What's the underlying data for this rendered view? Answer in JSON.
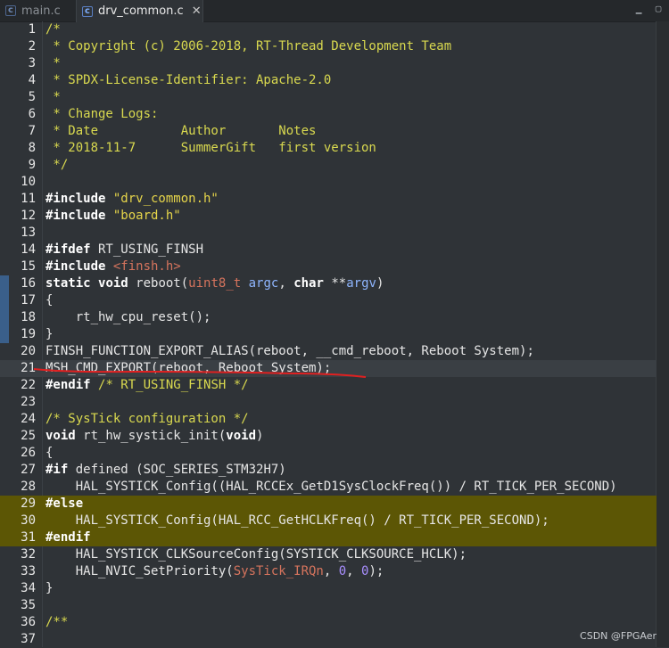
{
  "tabs": [
    {
      "label": "main.c",
      "active": false
    },
    {
      "label": "drv_common.c",
      "active": true
    }
  ],
  "watermark": "CSDN @FPGAer",
  "lines": [
    {
      "n": "1",
      "segs": [
        [
          "cmt",
          "/*"
        ]
      ]
    },
    {
      "n": "2",
      "segs": [
        [
          "cmt",
          " * Copyright (c) 2006-2018, RT-Thread Development Team"
        ]
      ]
    },
    {
      "n": "3",
      "segs": [
        [
          "cmt",
          " *"
        ]
      ]
    },
    {
      "n": "4",
      "segs": [
        [
          "cmt",
          " * SPDX-License-Identifier: Apache-2.0"
        ]
      ]
    },
    {
      "n": "5",
      "segs": [
        [
          "cmt",
          " *"
        ]
      ]
    },
    {
      "n": "6",
      "segs": [
        [
          "cmt",
          " * Change Logs:"
        ]
      ]
    },
    {
      "n": "7",
      "segs": [
        [
          "cmt",
          " * Date           Author       Notes"
        ]
      ]
    },
    {
      "n": "8",
      "segs": [
        [
          "cmt",
          " * 2018-11-7      SummerGift   first version"
        ]
      ]
    },
    {
      "n": "9",
      "segs": [
        [
          "cmt",
          " */"
        ]
      ]
    },
    {
      "n": "10",
      "segs": []
    },
    {
      "n": "11",
      "segs": [
        [
          "pp",
          "#include "
        ],
        [
          "str",
          "\"drv_common.h\""
        ]
      ]
    },
    {
      "n": "12",
      "segs": [
        [
          "pp",
          "#include "
        ],
        [
          "str",
          "\"board.h\""
        ]
      ]
    },
    {
      "n": "13",
      "segs": []
    },
    {
      "n": "14",
      "segs": [
        [
          "pp",
          "#ifdef"
        ],
        [
          "",
          " RT_USING_FINSH"
        ]
      ]
    },
    {
      "n": "15",
      "segs": [
        [
          "pp",
          "#include "
        ],
        [
          "inc",
          "<finsh.h>"
        ]
      ]
    },
    {
      "n": "16",
      "segs": [
        [
          "kw",
          "static"
        ],
        [
          "",
          " "
        ],
        [
          "kw",
          "void"
        ],
        [
          "",
          " reboot("
        ],
        [
          "typ",
          "uint8_t"
        ],
        [
          "",
          " "
        ],
        [
          "param",
          "argc"
        ],
        [
          "",
          ", "
        ],
        [
          "kw",
          "char"
        ],
        [
          "",
          " **"
        ],
        [
          "param",
          "argv"
        ],
        [
          "",
          ")"
        ]
      ]
    },
    {
      "n": "17",
      "segs": [
        [
          "",
          "{"
        ]
      ]
    },
    {
      "n": "18",
      "segs": [
        [
          "",
          "    rt_hw_cpu_reset();"
        ]
      ]
    },
    {
      "n": "19",
      "segs": [
        [
          "",
          "}"
        ]
      ]
    },
    {
      "n": "20",
      "segs": [
        [
          "",
          "FINSH_FUNCTION_EXPORT_ALIAS(reboot, __cmd_reboot, Reboot System);"
        ]
      ]
    },
    {
      "n": "21",
      "segs": [
        [
          "",
          "MSH_CMD_EXPORT(reboot, Reboot System);"
        ]
      ]
    },
    {
      "n": "22",
      "segs": [
        [
          "pp",
          "#endif"
        ],
        [
          "",
          " "
        ],
        [
          "cmt",
          "/* RT_USING_FINSH */"
        ]
      ]
    },
    {
      "n": "23",
      "segs": []
    },
    {
      "n": "24",
      "segs": [
        [
          "cmt",
          "/* SysTick configuration */"
        ]
      ]
    },
    {
      "n": "25",
      "segs": [
        [
          "kw",
          "void"
        ],
        [
          "",
          " rt_hw_systick_init("
        ],
        [
          "kw",
          "void"
        ],
        [
          "",
          ")"
        ]
      ]
    },
    {
      "n": "26",
      "segs": [
        [
          "",
          "{"
        ]
      ]
    },
    {
      "n": "27",
      "segs": [
        [
          "pp",
          "#if"
        ],
        [
          "",
          " defined (SOC_SERIES_STM32H7)"
        ]
      ]
    },
    {
      "n": "28",
      "segs": [
        [
          "",
          "    HAL_SYSTICK_Config((HAL_RCCEx_GetD1SysClockFreq()) / RT_TICK_PER_SECOND)"
        ]
      ]
    },
    {
      "n": "29",
      "segs": [
        [
          "pp",
          "#else"
        ]
      ]
    },
    {
      "n": "30",
      "segs": [
        [
          "",
          "    HAL_SYSTICK_Config(HAL_RCC_GetHCLKFreq() / RT_TICK_PER_SECOND);"
        ]
      ]
    },
    {
      "n": "31",
      "segs": [
        [
          "pp",
          "#endif"
        ]
      ]
    },
    {
      "n": "32",
      "segs": [
        [
          "",
          "    HAL_SYSTICK_CLKSourceConfig(SYSTICK_CLKSOURCE_HCLK);"
        ]
      ]
    },
    {
      "n": "33",
      "segs": [
        [
          "",
          "    HAL_NVIC_SetPriority("
        ],
        [
          "typ",
          "SysTick_IRQn"
        ],
        [
          "",
          ", "
        ],
        [
          "num",
          "0"
        ],
        [
          "",
          ", "
        ],
        [
          "num",
          "0"
        ],
        [
          "",
          ");"
        ]
      ]
    },
    {
      "n": "34",
      "segs": [
        [
          "",
          "}"
        ]
      ]
    },
    {
      "n": "35",
      "segs": []
    },
    {
      "n": "36",
      "segs": [
        [
          "cmt",
          "/**"
        ]
      ]
    },
    {
      "n": "37",
      "segs": []
    }
  ],
  "current_line": "21",
  "highlighted_lines": [
    "29",
    "30",
    "31"
  ],
  "marked_lines": [
    "16",
    "17",
    "18",
    "19"
  ],
  "colors": {
    "background": "#2f3337",
    "comment": "#d9d94f",
    "highlight": "#5c5605",
    "annotation": "#e02020"
  }
}
